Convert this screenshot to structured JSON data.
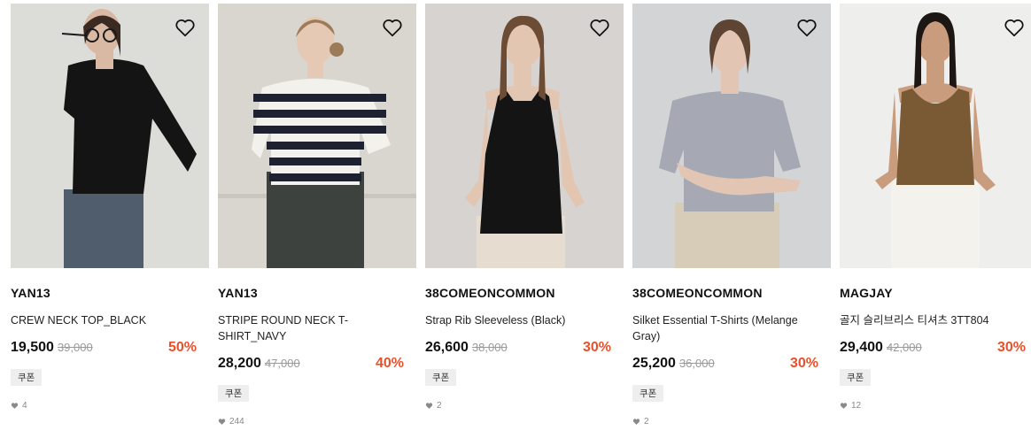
{
  "products": [
    {
      "brand": "YAN13",
      "name": "CREW NECK TOP_BLACK",
      "price": "19,500",
      "original_price": "39,000",
      "discount": "50%",
      "coupon": "쿠폰",
      "likes": "4"
    },
    {
      "brand": "YAN13",
      "name": "STRIPE ROUND NECK T-SHIRT_NAVY",
      "price": "28,200",
      "original_price": "47,000",
      "discount": "40%",
      "coupon": "쿠폰",
      "likes": "244"
    },
    {
      "brand": "38COMEONCOMMON",
      "name": "Strap Rib Sleeveless (Black)",
      "price": "26,600",
      "original_price": "38,000",
      "discount": "30%",
      "coupon": "쿠폰",
      "likes": "2"
    },
    {
      "brand": "38COMEONCOMMON",
      "name": "Silket Essential T-Shirts (Melange Gray)",
      "price": "25,200",
      "original_price": "36,000",
      "discount": "30%",
      "coupon": "쿠폰",
      "likes": "2"
    },
    {
      "brand": "MAGJAY",
      "name": "골지 슬리브리스 티셔츠 3TT804",
      "price": "29,400",
      "original_price": "42,000",
      "discount": "30%",
      "coupon": "쿠폰",
      "likes": "12"
    }
  ],
  "icons": {
    "wishlist": "heart-outline-icon",
    "likes": "heart-filled-icon"
  },
  "colors": {
    "discount": "#e8502a",
    "coupon_bg": "#eeeeee",
    "muted": "#888888"
  }
}
